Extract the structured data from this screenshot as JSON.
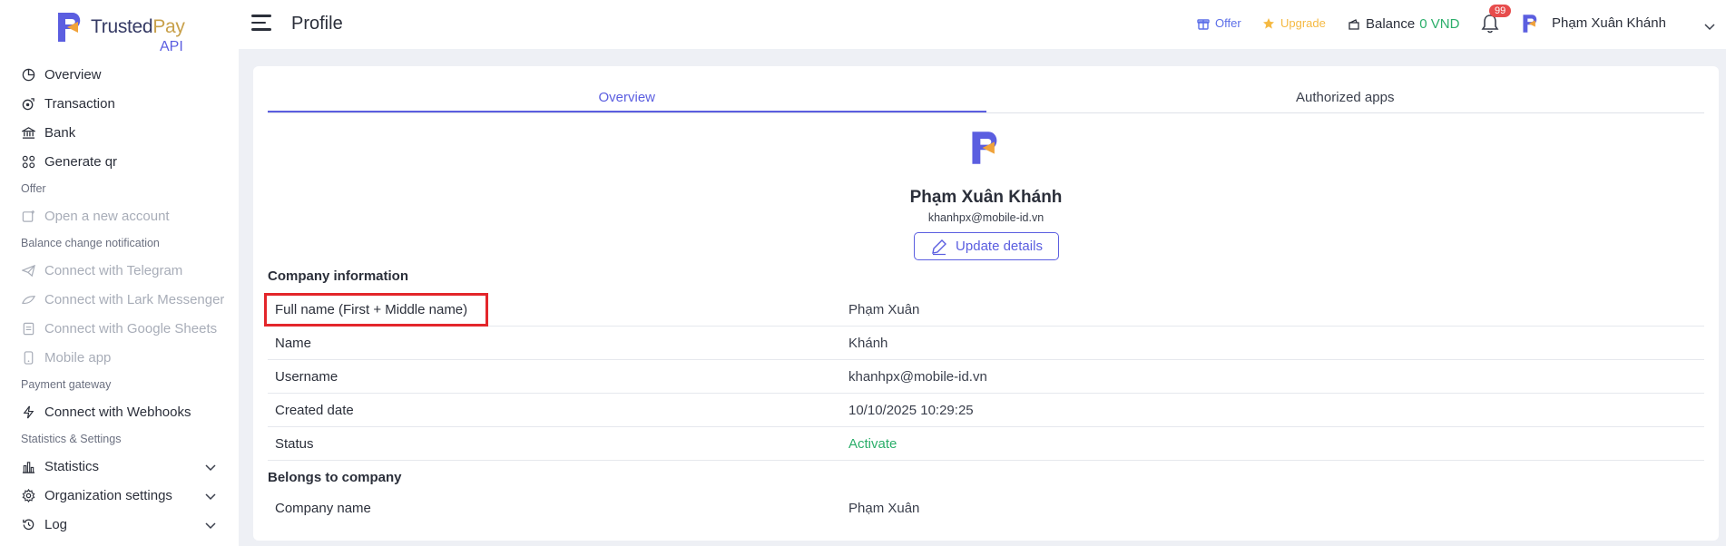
{
  "app": {
    "logo_text_trusted": "Trusted",
    "logo_text_pay": "Pay",
    "logo_sub": "API"
  },
  "sidebar": {
    "items": [
      {
        "type": "item",
        "label": "Overview",
        "icon": "pie-chart-icon",
        "disabled": false
      },
      {
        "type": "item",
        "label": "Transaction",
        "icon": "coin-transfer-icon",
        "disabled": false
      },
      {
        "type": "item",
        "label": "Bank",
        "icon": "bank-icon",
        "disabled": false
      },
      {
        "type": "item",
        "label": "Generate qr",
        "icon": "qr-icon",
        "disabled": false
      },
      {
        "type": "section",
        "label": "Offer"
      },
      {
        "type": "item",
        "label": "Open a new account",
        "icon": "add-account-icon",
        "disabled": true
      },
      {
        "type": "section",
        "label": "Balance change notification"
      },
      {
        "type": "item",
        "label": "Connect with Telegram",
        "icon": "telegram-icon",
        "disabled": true
      },
      {
        "type": "item",
        "label": "Connect with Lark Messenger",
        "icon": "lark-icon",
        "disabled": true
      },
      {
        "type": "item",
        "label": "Connect with Google Sheets",
        "icon": "sheets-icon",
        "disabled": true
      },
      {
        "type": "item",
        "label": "Mobile app",
        "icon": "mobile-icon",
        "disabled": true
      },
      {
        "type": "section",
        "label": "Payment gateway"
      },
      {
        "type": "item",
        "label": "Connect with Webhooks",
        "icon": "lightning-icon",
        "disabled": false
      },
      {
        "type": "section",
        "label": "Statistics & Settings"
      },
      {
        "type": "item",
        "label": "Statistics",
        "icon": "bar-chart-icon",
        "disabled": false,
        "expandable": true
      },
      {
        "type": "item",
        "label": "Organization settings",
        "icon": "gear-icon",
        "disabled": false,
        "expandable": true
      },
      {
        "type": "item",
        "label": "Log",
        "icon": "history-icon",
        "disabled": false,
        "expandable": true
      }
    ]
  },
  "header": {
    "title": "Profile",
    "offer_label": "Offer",
    "upgrade_label": "Upgrade",
    "balance_label": "Balance",
    "balance_value": "0 VND",
    "notification_count": "99",
    "user_name": "Phạm Xuân Khánh"
  },
  "tabs": [
    {
      "label": "Overview",
      "active": true
    },
    {
      "label": "Authorized apps",
      "active": false
    }
  ],
  "profile": {
    "name": "Phạm Xuân Khánh",
    "email": "khanhpx@mobile-id.vn",
    "update_button": "Update details"
  },
  "company_info": {
    "title": "Company information",
    "rows": [
      {
        "key": "Full name (First + Middle name)",
        "value": "Phạm Xuân",
        "status": false
      },
      {
        "key": "Name",
        "value": "Khánh",
        "status": false
      },
      {
        "key": "Username",
        "value": "khanhpx@mobile-id.vn",
        "status": false
      },
      {
        "key": "Created date",
        "value": "10/10/2025 10:29:25",
        "status": false
      },
      {
        "key": "Status",
        "value": "Activate",
        "status": true
      }
    ]
  },
  "belongs": {
    "title": "Belongs to company",
    "rows": [
      {
        "key": "Company name",
        "value": "Phạm Xuân"
      }
    ]
  },
  "colors": {
    "accent": "#5b5ee0",
    "success": "#2bae6a",
    "highlight": "#e3262b",
    "upgrade": "#f5b942",
    "badge": "#e74c4c"
  }
}
